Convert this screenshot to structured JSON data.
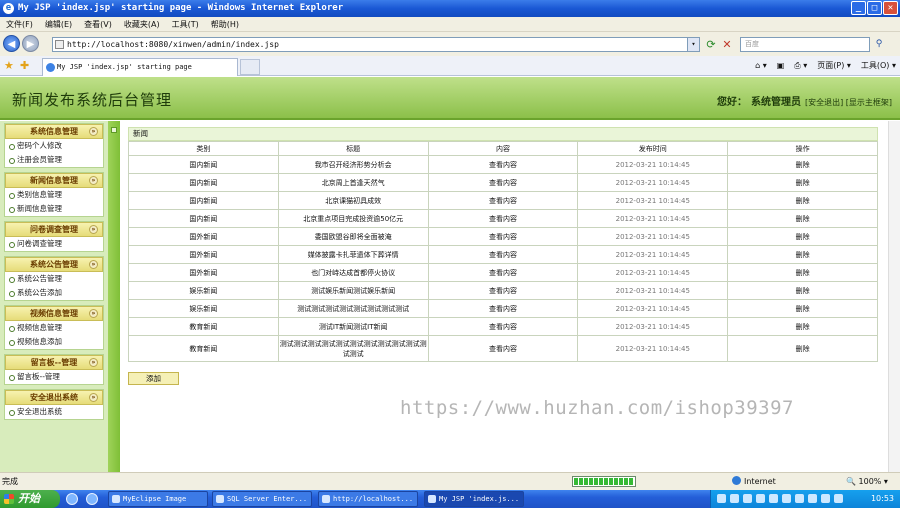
{
  "window": {
    "title": "My JSP 'index.jsp' starting page - Windows Internet Explorer"
  },
  "menubar": [
    "文件(F)",
    "编辑(E)",
    "查看(V)",
    "收藏夹(A)",
    "工具(T)",
    "帮助(H)"
  ],
  "address": {
    "url": "http://localhost:8080/xinwen/admin/index.jsp",
    "search_placeholder": "百度"
  },
  "tab": {
    "title": "My JSP 'index.jsp' starting page"
  },
  "cmdbar": [
    "页面(P) ▾",
    "工具(O) ▾"
  ],
  "header": {
    "site_title": "新闻发布系统后台管理",
    "greeting": "您好：",
    "user": "系统管理员",
    "links": "[安全退出] [显示主框架]"
  },
  "sidebar": {
    "groups": [
      {
        "title": "系统信息管理",
        "items": [
          "密码个人修改",
          "注册会员管理"
        ]
      },
      {
        "title": "新闻信息管理",
        "items": [
          "类别信息管理",
          "新闻信息管理"
        ]
      },
      {
        "title": "问卷调查管理",
        "items": [
          "问卷调查管理"
        ]
      },
      {
        "title": "系统公告管理",
        "items": [
          "系统公告管理",
          "系统公告添加"
        ]
      },
      {
        "title": "视频信息管理",
        "items": [
          "视频信息管理",
          "视频信息添加"
        ]
      },
      {
        "title": "留言板--管理",
        "items": [
          "留言板--管理"
        ]
      },
      {
        "title": "安全退出系统",
        "items": [
          "安全退出系统"
        ]
      }
    ]
  },
  "main": {
    "panel_title": "新闻",
    "columns": [
      "类别",
      "标题",
      "内容",
      "发布时间",
      "操作"
    ],
    "rows": [
      {
        "category": "国内新闻",
        "title": "我市召开经济形势分析会",
        "content": "查看内容",
        "time": "2012-03-21 10:14:45",
        "action": "删除"
      },
      {
        "category": "国内新闻",
        "title": "北京周上首逢天然气",
        "content": "查看内容",
        "time": "2012-03-21 10:14:45",
        "action": "删除"
      },
      {
        "category": "国内新闻",
        "title": "北京课猫初具成效",
        "content": "查看内容",
        "time": "2012-03-21 10:14:45",
        "action": "删除"
      },
      {
        "category": "国内新闻",
        "title": "北京重点项目完成投资逾50亿元",
        "content": "查看内容",
        "time": "2012-03-21 10:14:45",
        "action": "删除"
      },
      {
        "category": "国外新闻",
        "title": "委国欧盟谷即将全面被淹",
        "content": "查看内容",
        "time": "2012-03-21 10:14:45",
        "action": "删除"
      },
      {
        "category": "国外新闻",
        "title": "媒体披露卡扎菲遗体下葬详情",
        "content": "查看内容",
        "time": "2012-03-21 10:14:45",
        "action": "删除"
      },
      {
        "category": "国外新闻",
        "title": "也门对峙达成首都停火协议",
        "content": "查看内容",
        "time": "2012-03-21 10:14:45",
        "action": "删除"
      },
      {
        "category": "娱乐新闻",
        "title": "测试娱乐新闻测试娱乐新闻",
        "content": "查看内容",
        "time": "2012-03-21 10:14:45",
        "action": "删除"
      },
      {
        "category": "娱乐新闻",
        "title": "测试测试测试测试测试测试测试测试",
        "content": "查看内容",
        "time": "2012-03-21 10:14:45",
        "action": "删除"
      },
      {
        "category": "教育新闻",
        "title": "测试IT新闻测试IT新闻",
        "content": "查看内容",
        "time": "2012-03-21 10:14:45",
        "action": "删除"
      },
      {
        "category": "教育新闻",
        "title": "测试测试测试测试测试测试测试测试测试测试测试测试",
        "content": "查看内容",
        "time": "2012-03-21 10:14:45",
        "action": "删除"
      }
    ],
    "add_label": "添加",
    "watermark": "https://www.huzhan.com/ishop39397"
  },
  "statusbar": {
    "status": "完成",
    "zone": "Internet",
    "zoom": "100%",
    "progress": 1.0
  },
  "taskbar": {
    "start": "开始",
    "tasks": [
      "MyEclipse Image",
      "SQL Server Enter...",
      "http://localhost...",
      "My JSP 'index.js..."
    ],
    "clock": "10:53"
  },
  "colors": {
    "header_green": "#8cc04a",
    "sidebar_green": "#d8ecbc",
    "title_blue": "#1a58d4"
  }
}
